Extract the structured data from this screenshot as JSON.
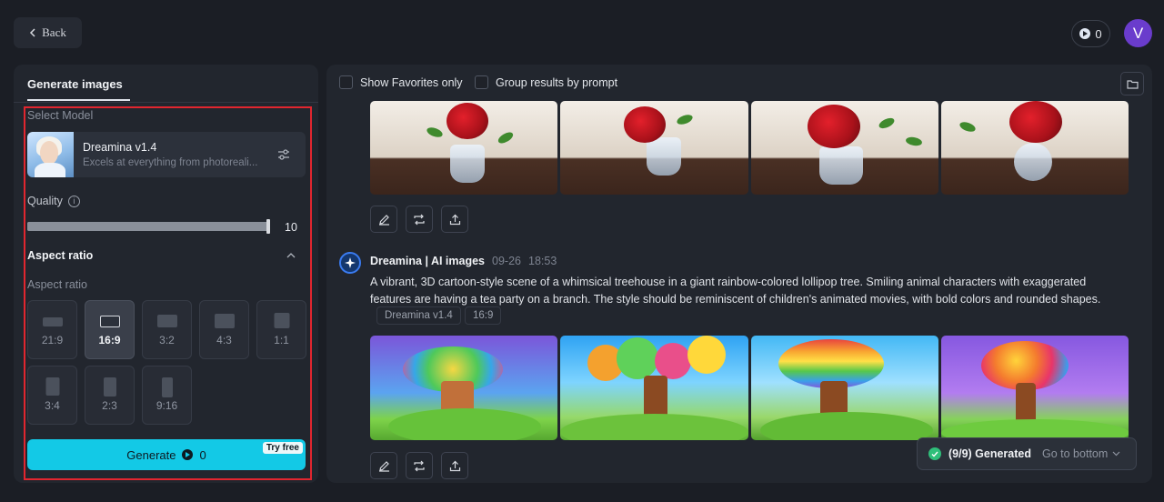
{
  "header": {
    "back_label": "Back",
    "credits": "0",
    "avatar_letter": "V"
  },
  "left_panel": {
    "tab_label": "Generate images",
    "select_model_label": "Select Model",
    "model": {
      "name": "Dreamina v1.4",
      "description": "Excels at everything from photoreali..."
    },
    "quality": {
      "label": "Quality",
      "value": "10",
      "level": 1.0
    },
    "aspect_ratio_header": "Aspect ratio",
    "aspect_ratio_sub": "Aspect ratio",
    "ratios": [
      {
        "label": "21:9",
        "active": false
      },
      {
        "label": "16:9",
        "active": true
      },
      {
        "label": "3:2",
        "active": false
      },
      {
        "label": "4:3",
        "active": false
      },
      {
        "label": "1:1",
        "active": false
      },
      {
        "label": "3:4",
        "active": false
      },
      {
        "label": "2:3",
        "active": false
      },
      {
        "label": "9:16",
        "active": false
      }
    ],
    "generate": {
      "label": "Generate",
      "credits": "0",
      "badge": "Try free"
    },
    "highlight_color": "#e1262f",
    "accent_color": "#13c9e6"
  },
  "right_panel": {
    "show_favorites_label": "Show Favorites only",
    "group_results_label": "Group results by prompt",
    "post": {
      "author": "Dreamina | AI images",
      "date": "09-26",
      "time": "18:53",
      "prompt": "A vibrant, 3D cartoon-style scene of a whimsical treehouse in a giant rainbow-colored lollipop tree. Smiling animal characters with exaggerated features are having a tea party on a branch. The style should be reminiscent of children's animated movies, with bold colors and rounded shapes.",
      "tags": [
        "Dreamina v1.4",
        "16:9"
      ]
    }
  },
  "toast": {
    "status": "(9/9) Generated",
    "link": "Go to bottom"
  }
}
